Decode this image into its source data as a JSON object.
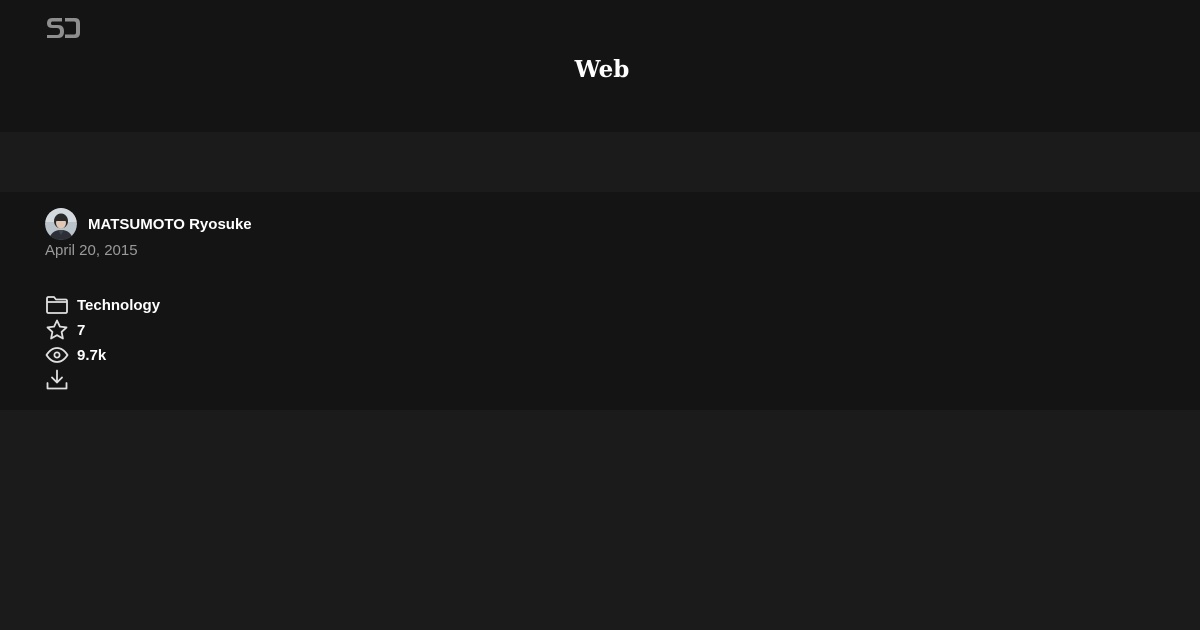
{
  "header": {
    "logo_icon": "speakerdeck-logo-icon",
    "title": "Web"
  },
  "presentation": {
    "author": {
      "avatar": "avatar",
      "name": "MATSUMOTO Ryosuke"
    },
    "date": "April 20, 2015",
    "stats": {
      "category": {
        "icon": "folder-icon",
        "label": "Technology"
      },
      "stars": {
        "icon": "star-icon",
        "value": "7"
      },
      "views": {
        "icon": "eye-icon",
        "value": "9.7k"
      },
      "download": {
        "icon": "download-icon"
      }
    }
  },
  "colors": {
    "header_bg": "#141414",
    "page_bg": "#1b1b1b",
    "text": "#ffffff",
    "muted_text": "#9a9a9a",
    "icon": "#e0e0e0"
  }
}
